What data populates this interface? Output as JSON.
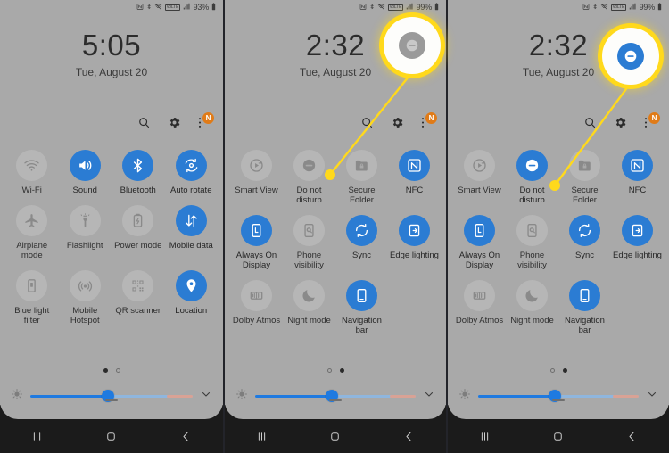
{
  "meta": {
    "accent_blue": "#2b7cd3",
    "panel_bg": "#a9a9a9",
    "highlight_yellow": "#ffd91c",
    "navbar_bg": "#1b1b1b",
    "badge_orange": "#e07b18"
  },
  "panels": [
    {
      "id": "panel-1",
      "status": {
        "battery_percent": "93%",
        "icons": [
          "nfc-icon",
          "bluetooth-icon",
          "wifi-icon",
          "volte-icon",
          "signal-icon",
          "battery-icon"
        ]
      },
      "clock": {
        "time": "5:05",
        "date": "Tue, August 20"
      },
      "header_icons": [
        {
          "name": "search-icon",
          "badge": ""
        },
        {
          "name": "gear-icon",
          "badge": ""
        },
        {
          "name": "overflow-menu-icon",
          "badge": "N"
        }
      ],
      "tiles": [
        {
          "label": "Wi-Fi",
          "icon": "wifi-icon",
          "on": false
        },
        {
          "label": "Sound",
          "icon": "sound-icon",
          "on": true
        },
        {
          "label": "Bluetooth",
          "icon": "bluetooth-icon",
          "on": true
        },
        {
          "label": "Auto rotate",
          "icon": "auto-rotate-icon",
          "on": true
        },
        {
          "label": "Airplane mode",
          "icon": "airplane-icon",
          "on": false
        },
        {
          "label": "Flashlight",
          "icon": "flashlight-icon",
          "on": false
        },
        {
          "label": "Power mode",
          "icon": "power-mode-icon",
          "on": false
        },
        {
          "label": "Mobile data",
          "icon": "mobile-data-icon",
          "on": true
        },
        {
          "label": "Blue light filter",
          "icon": "blue-light-icon",
          "on": false
        },
        {
          "label": "Mobile Hotspot",
          "icon": "hotspot-icon",
          "on": false
        },
        {
          "label": "QR scanner",
          "icon": "qr-scanner-icon",
          "on": false
        },
        {
          "label": "Location",
          "icon": "location-icon",
          "on": true
        }
      ],
      "page_dots": {
        "count": 2,
        "active_index": 0
      },
      "brightness": {
        "value_percent": 48,
        "warm_percent": 16
      },
      "callout": null
    },
    {
      "id": "panel-2",
      "status": {
        "battery_percent": "99%",
        "icons": [
          "nfc-icon",
          "bluetooth-icon",
          "wifi-icon",
          "volte-icon",
          "signal-icon",
          "battery-icon"
        ]
      },
      "clock": {
        "time": "2:32",
        "date": "Tue, August 20"
      },
      "header_icons": [
        {
          "name": "search-icon",
          "badge": ""
        },
        {
          "name": "gear-icon",
          "badge": ""
        },
        {
          "name": "overflow-menu-icon",
          "badge": "N"
        }
      ],
      "tiles": [
        {
          "label": "Smart View",
          "icon": "smart-view-icon",
          "on": false
        },
        {
          "label": "Do not disturb",
          "icon": "do-not-disturb-icon",
          "on": false
        },
        {
          "label": "Secure Folder",
          "icon": "secure-folder-icon",
          "on": false
        },
        {
          "label": "NFC",
          "icon": "nfc-icon",
          "on": true
        },
        {
          "label": "Always On Display",
          "icon": "always-on-display-icon",
          "on": true
        },
        {
          "label": "Phone visibility",
          "icon": "phone-visibility-icon",
          "on": false
        },
        {
          "label": "Sync",
          "icon": "sync-icon",
          "on": true
        },
        {
          "label": "Edge lighting",
          "icon": "edge-lighting-icon",
          "on": true
        },
        {
          "label": "Dolby Atmos",
          "icon": "dolby-atmos-icon",
          "on": false
        },
        {
          "label": "Night mode",
          "icon": "night-mode-icon",
          "on": false
        },
        {
          "label": "Navigation bar",
          "icon": "navigation-bar-icon",
          "on": true
        }
      ],
      "page_dots": {
        "count": 2,
        "active_index": 1
      },
      "brightness": {
        "value_percent": 48,
        "warm_percent": 16
      },
      "callout": {
        "icon": "do-not-disturb-icon",
        "on": false
      }
    },
    {
      "id": "panel-3",
      "status": {
        "battery_percent": "99%",
        "icons": [
          "nfc-icon",
          "bluetooth-icon",
          "wifi-icon",
          "volte-icon",
          "signal-icon",
          "battery-icon"
        ]
      },
      "clock": {
        "time": "2:32",
        "date": "Tue, August 20"
      },
      "header_icons": [
        {
          "name": "search-icon",
          "badge": ""
        },
        {
          "name": "gear-icon",
          "badge": ""
        },
        {
          "name": "overflow-menu-icon",
          "badge": "N"
        }
      ],
      "tiles": [
        {
          "label": "Smart View",
          "icon": "smart-view-icon",
          "on": false
        },
        {
          "label": "Do not disturb",
          "icon": "do-not-disturb-icon",
          "on": true
        },
        {
          "label": "Secure Folder",
          "icon": "secure-folder-icon",
          "on": false
        },
        {
          "label": "NFC",
          "icon": "nfc-icon",
          "on": true
        },
        {
          "label": "Always On Display",
          "icon": "always-on-display-icon",
          "on": true
        },
        {
          "label": "Phone visibility",
          "icon": "phone-visibility-icon",
          "on": false
        },
        {
          "label": "Sync",
          "icon": "sync-icon",
          "on": true
        },
        {
          "label": "Edge lighting",
          "icon": "edge-lighting-icon",
          "on": true
        },
        {
          "label": "Dolby Atmos",
          "icon": "dolby-atmos-icon",
          "on": false
        },
        {
          "label": "Night mode",
          "icon": "night-mode-icon",
          "on": false
        },
        {
          "label": "Navigation bar",
          "icon": "navigation-bar-icon",
          "on": true
        }
      ],
      "page_dots": {
        "count": 2,
        "active_index": 1
      },
      "brightness": {
        "value_percent": 48,
        "warm_percent": 16
      },
      "callout": {
        "icon": "do-not-disturb-icon",
        "on": true
      }
    }
  ],
  "navbar": {
    "recents_label": "Recents",
    "home_label": "Home",
    "back_label": "Back"
  }
}
